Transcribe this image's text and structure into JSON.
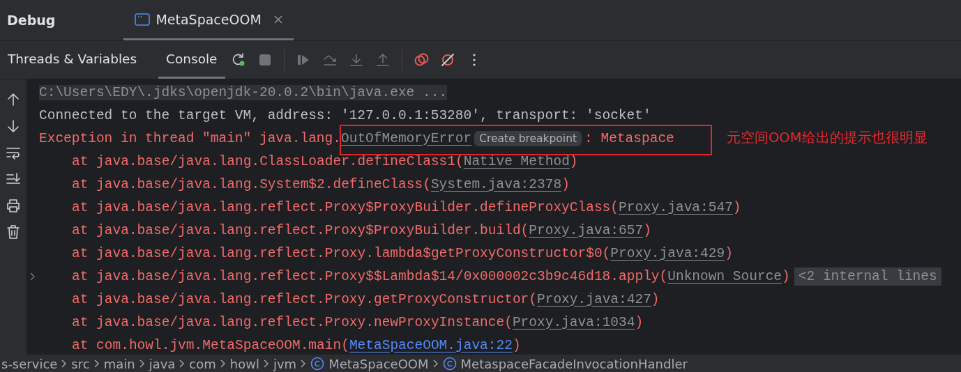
{
  "panel": {
    "title": "Debug",
    "tabs": [
      {
        "label": "MetaSpaceOOM",
        "selected": true
      }
    ]
  },
  "subtabs": [
    {
      "label": "Threads & Variables",
      "selected": false
    },
    {
      "label": "Console",
      "selected": true
    }
  ],
  "console": {
    "lines": [
      {
        "kind": "command",
        "foldable": false,
        "segments": [
          {
            "kind": "plain",
            "text": "C:\\Users\\EDY\\.jdks\\openjdk-20.0.2\\bin\\java.exe ..."
          }
        ]
      },
      {
        "kind": "info",
        "foldable": false,
        "segments": [
          {
            "kind": "plain",
            "text": "Connected to the target VM, address: '127.0.0.1:53280', transport: 'socket'"
          }
        ]
      },
      {
        "kind": "error",
        "foldable": false,
        "segments": [
          {
            "kind": "plain",
            "text": "Exception in thread \"main\" java.lang."
          },
          {
            "kind": "link",
            "text": "OutOfMemoryError"
          },
          {
            "kind": "hint",
            "text": "Create breakpoint"
          },
          {
            "kind": "plain",
            "text": ": Metaspace"
          }
        ]
      },
      {
        "kind": "frame",
        "foldable": false,
        "segments": [
          {
            "kind": "plain",
            "text": "at java.base/java.lang.ClassLoader.defineClass1("
          },
          {
            "kind": "link",
            "text": "Native Method"
          },
          {
            "kind": "plain",
            "text": ")"
          }
        ]
      },
      {
        "kind": "frame",
        "foldable": false,
        "segments": [
          {
            "kind": "plain",
            "text": "at java.base/java.lang.System$2.defineClass("
          },
          {
            "kind": "link",
            "text": "System.java:2378"
          },
          {
            "kind": "plain",
            "text": ")"
          }
        ]
      },
      {
        "kind": "frame",
        "foldable": false,
        "segments": [
          {
            "kind": "plain",
            "text": "at java.base/java.lang.reflect.Proxy$ProxyBuilder.defineProxyClass("
          },
          {
            "kind": "link",
            "text": "Proxy.java:547"
          },
          {
            "kind": "plain",
            "text": ")"
          }
        ]
      },
      {
        "kind": "frame",
        "foldable": false,
        "segments": [
          {
            "kind": "plain",
            "text": "at java.base/java.lang.reflect.Proxy$ProxyBuilder.build("
          },
          {
            "kind": "link",
            "text": "Proxy.java:657"
          },
          {
            "kind": "plain",
            "text": ")"
          }
        ]
      },
      {
        "kind": "frame",
        "foldable": false,
        "segments": [
          {
            "kind": "plain",
            "text": "at java.base/java.lang.reflect.Proxy.lambda$getProxyConstructor$0("
          },
          {
            "kind": "link",
            "text": "Proxy.java:429"
          },
          {
            "kind": "plain",
            "text": ")"
          }
        ]
      },
      {
        "kind": "frame",
        "foldable": true,
        "segments": [
          {
            "kind": "plain",
            "text": "at java.base/java.lang.reflect.Proxy$$Lambda$14/0x000002c3b9c46d18.apply("
          },
          {
            "kind": "link",
            "text": "Unknown Source"
          },
          {
            "kind": "plain",
            "text": ")"
          },
          {
            "kind": "folded",
            "text": "<2 internal lines"
          }
        ]
      },
      {
        "kind": "frame",
        "foldable": false,
        "segments": [
          {
            "kind": "plain",
            "text": "at java.base/java.lang.reflect.Proxy.getProxyConstructor("
          },
          {
            "kind": "link",
            "text": "Proxy.java:427"
          },
          {
            "kind": "plain",
            "text": ")"
          }
        ]
      },
      {
        "kind": "frame",
        "foldable": false,
        "segments": [
          {
            "kind": "plain",
            "text": "at java.base/java.lang.reflect.Proxy.newProxyInstance("
          },
          {
            "kind": "link",
            "text": "Proxy.java:1034"
          },
          {
            "kind": "plain",
            "text": ")"
          }
        ]
      },
      {
        "kind": "frame",
        "foldable": false,
        "segments": [
          {
            "kind": "plain",
            "text": "at com.howl.jvm.MetaSpaceOOM.main("
          },
          {
            "kind": "source_link",
            "text": "MetaSpaceOOM.java:22"
          },
          {
            "kind": "plain",
            "text": ")"
          }
        ]
      }
    ]
  },
  "annotation": {
    "text": "元空间OOM给出的提示也很明显"
  },
  "breadcrumbs": [
    {
      "kind": "folder",
      "label": "s-service"
    },
    {
      "kind": "folder",
      "label": "src"
    },
    {
      "kind": "folder",
      "label": "main"
    },
    {
      "kind": "folder",
      "label": "java"
    },
    {
      "kind": "folder",
      "label": "com"
    },
    {
      "kind": "folder",
      "label": "howl"
    },
    {
      "kind": "folder",
      "label": "jvm"
    },
    {
      "kind": "class",
      "label": "MetaSpaceOOM"
    },
    {
      "kind": "class",
      "label": "MetaspaceFacadeInvocationHandler"
    }
  ]
}
